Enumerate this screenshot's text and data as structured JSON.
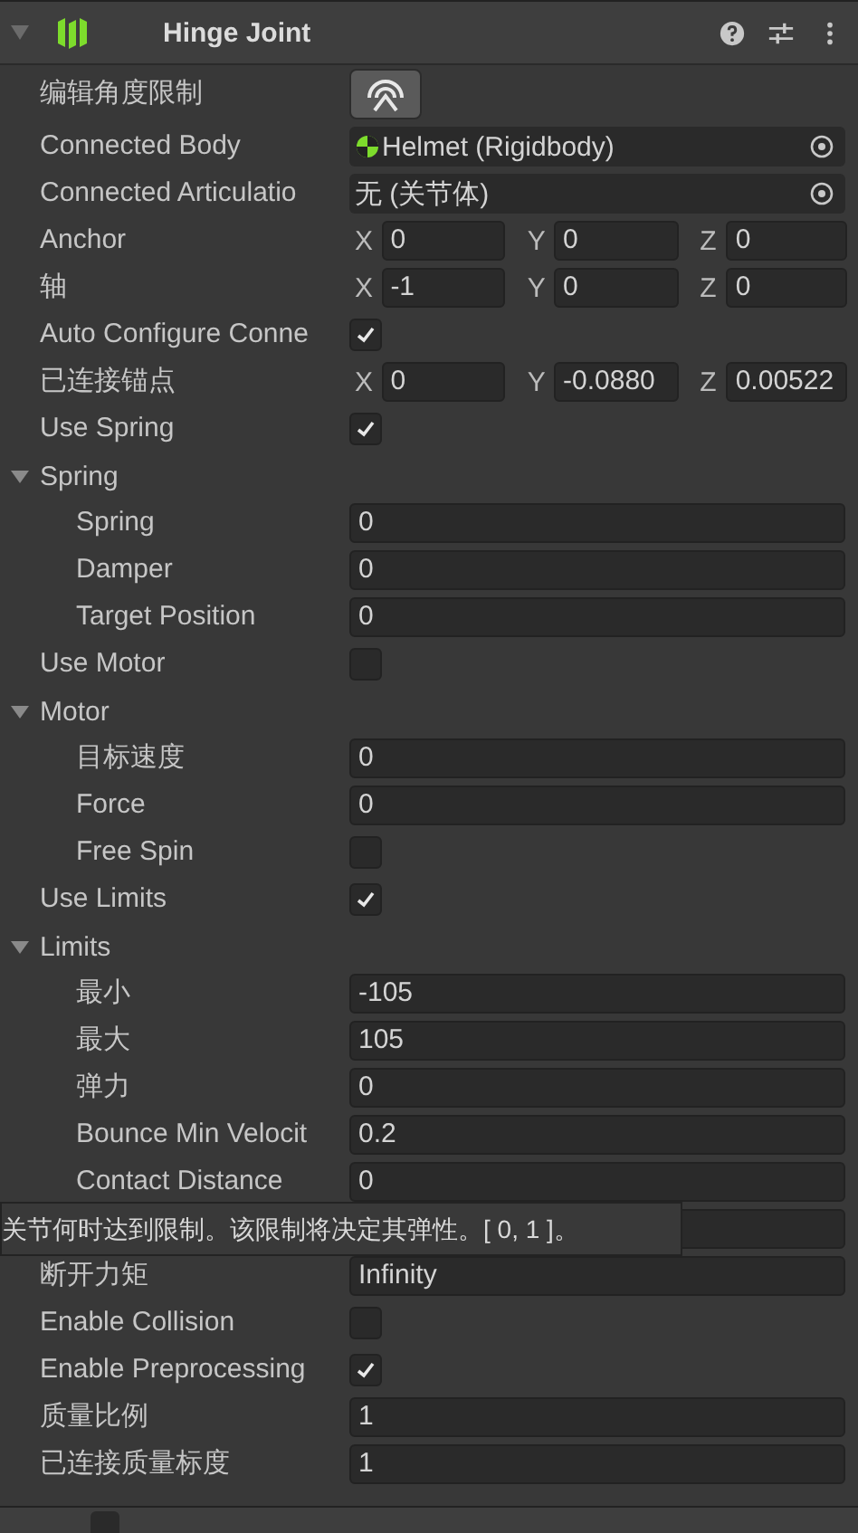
{
  "component": {
    "title": "Hinge Joint",
    "expanded": true
  },
  "properties": [
    {
      "kind": "button",
      "label": "编辑角度限制"
    },
    {
      "kind": "object",
      "label": "Connected Body",
      "value": "Helmet (Rigidbody)",
      "has_icon": true
    },
    {
      "kind": "object",
      "label": "Connected Articulatio",
      "value": "无 (关节体)",
      "has_icon": false
    },
    {
      "kind": "vector",
      "label": "Anchor",
      "components": [
        {
          "axis": "X",
          "value": "0"
        },
        {
          "axis": "Y",
          "value": "0"
        },
        {
          "axis": "Z",
          "value": "0"
        }
      ]
    },
    {
      "kind": "vector",
      "label": "轴",
      "components": [
        {
          "axis": "X",
          "value": "-1"
        },
        {
          "axis": "Y",
          "value": "0"
        },
        {
          "axis": "Z",
          "value": "0"
        }
      ]
    },
    {
      "kind": "checkbox",
      "label": "Auto Configure Conne",
      "checked": true
    },
    {
      "kind": "vector",
      "label": "已连接锚点",
      "components": [
        {
          "axis": "X",
          "value": "0"
        },
        {
          "axis": "Y",
          "value": "-0.0880"
        },
        {
          "axis": "Z",
          "value": "0.00522"
        }
      ]
    },
    {
      "kind": "checkbox",
      "label": "Use Spring",
      "checked": true
    },
    {
      "kind": "foldout",
      "label": "Spring",
      "expanded": true,
      "children": [
        {
          "kind": "field",
          "label": "Spring",
          "value": "0"
        },
        {
          "kind": "field",
          "label": "Damper",
          "value": "0"
        },
        {
          "kind": "field",
          "label": "Target Position",
          "value": "0"
        }
      ]
    },
    {
      "kind": "checkbox",
      "label": "Use Motor",
      "checked": false
    },
    {
      "kind": "foldout",
      "label": "Motor",
      "expanded": true,
      "children": [
        {
          "kind": "field",
          "label": "目标速度",
          "value": "0"
        },
        {
          "kind": "field",
          "label": "Force",
          "value": "0"
        },
        {
          "kind": "checkbox",
          "label": "Free Spin",
          "checked": false
        }
      ]
    },
    {
      "kind": "checkbox",
      "label": "Use Limits",
      "checked": true
    },
    {
      "kind": "foldout",
      "label": "Limits",
      "expanded": true,
      "children": [
        {
          "kind": "field",
          "label": "最小",
          "value": "-105"
        },
        {
          "kind": "field",
          "label": "最大",
          "value": "105"
        },
        {
          "kind": "field",
          "label": "弹力",
          "value": "0"
        },
        {
          "kind": "field",
          "label": "Bounce Min Velocit",
          "value": "0.2"
        },
        {
          "kind": "field",
          "label": "Contact Distance",
          "value": "0"
        }
      ]
    },
    {
      "kind": "covered"
    },
    {
      "kind": "field",
      "label": "断开力矩",
      "value": "Infinity"
    },
    {
      "kind": "checkbox",
      "label": "Enable Collision",
      "checked": false
    },
    {
      "kind": "checkbox",
      "label": "Enable Preprocessing",
      "checked": true
    },
    {
      "kind": "field",
      "label": "质量比例",
      "value": "1"
    },
    {
      "kind": "field",
      "label": "已连接质量标度",
      "value": "1"
    }
  ],
  "next_component": {
    "enabled": false
  },
  "tooltip": {
    "text": "关节何时达到限制。该限制将决定其弹性。[ 0, 1 ]。"
  }
}
